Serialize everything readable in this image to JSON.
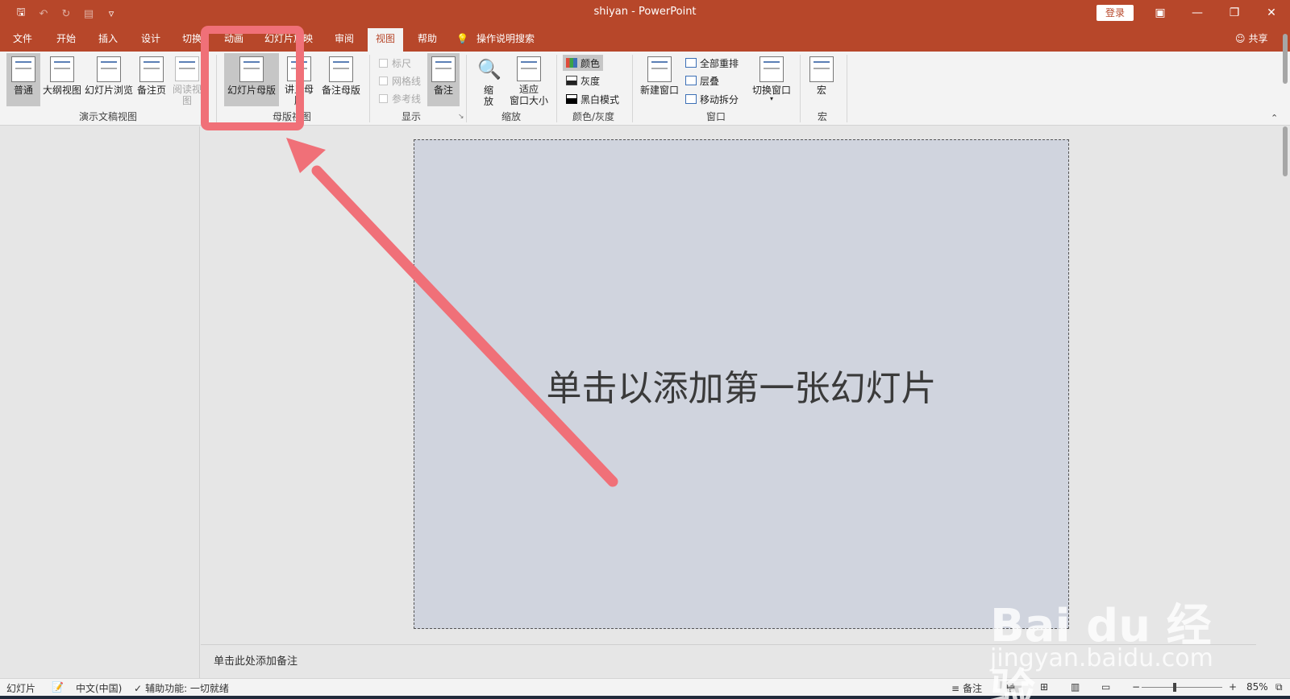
{
  "title": {
    "text": "shiyan  -  PowerPoint",
    "login": "登录"
  },
  "tabs": [
    "文件",
    "开始",
    "插入",
    "设计",
    "切换",
    "动画",
    "幻灯片放映",
    "审阅",
    "视图",
    "帮助"
  ],
  "active_tab": "视图",
  "tell_me": "操作说明搜索",
  "share": "共享",
  "ribbon": {
    "groups": {
      "presentation_views": "演示文稿视图",
      "master_views": "母版视图",
      "show": "显示",
      "zoom": "缩放",
      "color": "颜色/灰度",
      "window": "窗口",
      "macros": "宏"
    },
    "buttons": {
      "normal": "普通",
      "outline": "大纲视图",
      "sorter": "幻灯片浏览",
      "notes_page": "备注页",
      "reading": "阅读视图",
      "slide_master": "幻灯片母版",
      "handout_master": "讲义母版",
      "notes_master": "备注母版",
      "notes": "备注",
      "zoom": "缩\n放",
      "fit_window": "适应\n窗口大小",
      "new_window": "新建窗口",
      "switch_window": "切换窗口",
      "macros": "宏"
    },
    "checkboxes": {
      "ruler": "标尺",
      "gridlines": "网格线",
      "guides": "参考线"
    },
    "color_options": {
      "color": "颜色",
      "grayscale": "灰度",
      "bw": "黑白模式"
    },
    "window_options": {
      "arrange_all": "全部重排",
      "cascade": "层叠",
      "move_split": "移动拆分"
    }
  },
  "slide": {
    "placeholder": "单击以添加第一张幻灯片"
  },
  "notes": {
    "placeholder": "单击此处添加备注"
  },
  "status": {
    "slide": "幻灯片",
    "language": "中文(中国)",
    "accessibility": "辅助功能: 一切就绪",
    "notes_btn": "备注",
    "zoom_minus": "−",
    "zoom_plus": "+",
    "zoom_level": "85%"
  },
  "watermark": {
    "brand": "Bai du 经验",
    "url": "jingyan.baidu.com"
  },
  "colors": {
    "accent": "#b7472a",
    "annotation": "#f07078"
  }
}
